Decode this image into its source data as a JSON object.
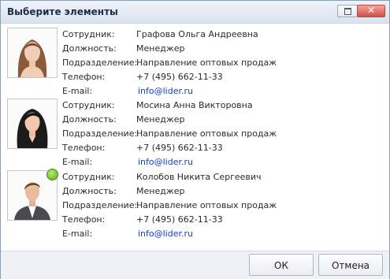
{
  "window": {
    "title": "Выберите элементы",
    "restore_icon": "restore-icon",
    "close_icon": "close-icon",
    "close_glyph": "✕"
  },
  "labels": {
    "employee": "Сотрудник:",
    "position": "Должность:",
    "department": "Подразделение:",
    "phone": "Телефон:",
    "email": "E-mail:"
  },
  "employees": [
    {
      "name": "Графова Ольга Андреевна",
      "position": "Менеджер",
      "department": "Направление оптовых продаж",
      "phone": "+7 (495) 662-11-33",
      "email": "info@lider.ru",
      "online": false
    },
    {
      "name": "Мосина Анна Викторовна",
      "position": "Менеджер",
      "department": "Направление оптовых продаж",
      "phone": "+7 (495) 662-11-33",
      "email": "info@lider.ru",
      "online": false
    },
    {
      "name": "Колобов Никита Сергеевич",
      "position": "Менеджер",
      "department": "Направление оптовых продаж",
      "phone": "+7 (495) 662-11-33",
      "email": "info@lider.ru",
      "online": true
    }
  ],
  "footer": {
    "ok_label": "ОК",
    "cancel_label": "Отмена"
  },
  "colors": {
    "link": "#1240c5",
    "online_status": "#5ea819",
    "title_text": "#1b2f4a"
  }
}
